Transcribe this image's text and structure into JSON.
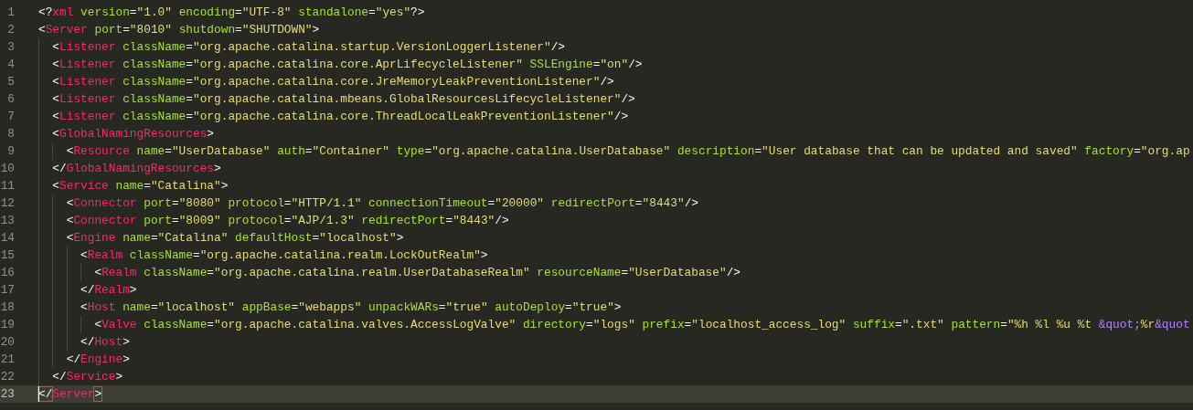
{
  "editor": {
    "lines": [
      {
        "number": "1",
        "text": "<?xml version=\"1.0\" encoding=\"UTF-8\" standalone=\"yes\"?>",
        "current": false
      },
      {
        "number": "2",
        "text": "<Server port=\"8010\" shutdown=\"SHUTDOWN\">",
        "current": false
      },
      {
        "number": "3",
        "text": "  <Listener className=\"org.apache.catalina.startup.VersionLoggerListener\"/>",
        "current": false
      },
      {
        "number": "4",
        "text": "  <Listener className=\"org.apache.catalina.core.AprLifecycleListener\" SSLEngine=\"on\"/>",
        "current": false
      },
      {
        "number": "5",
        "text": "  <Listener className=\"org.apache.catalina.core.JreMemoryLeakPreventionListener\"/>",
        "current": false
      },
      {
        "number": "6",
        "text": "  <Listener className=\"org.apache.catalina.mbeans.GlobalResourcesLifecycleListener\"/>",
        "current": false
      },
      {
        "number": "7",
        "text": "  <Listener className=\"org.apache.catalina.core.ThreadLocalLeakPreventionListener\"/>",
        "current": false
      },
      {
        "number": "8",
        "text": "  <GlobalNamingResources>",
        "current": false
      },
      {
        "number": "9",
        "text": "    <Resource name=\"UserDatabase\" auth=\"Container\" type=\"org.apache.catalina.UserDatabase\" description=\"User database that can be updated and saved\" factory=\"org.ap",
        "current": false
      },
      {
        "number": "10",
        "text": "  </GlobalNamingResources>",
        "current": false
      },
      {
        "number": "11",
        "text": "  <Service name=\"Catalina\">",
        "current": false
      },
      {
        "number": "12",
        "text": "    <Connector port=\"8080\" protocol=\"HTTP/1.1\" connectionTimeout=\"20000\" redirectPort=\"8443\"/>",
        "current": false
      },
      {
        "number": "13",
        "text": "    <Connector port=\"8009\" protocol=\"AJP/1.3\" redirectPort=\"8443\"/>",
        "current": false
      },
      {
        "number": "14",
        "text": "    <Engine name=\"Catalina\" defaultHost=\"localhost\">",
        "current": false
      },
      {
        "number": "15",
        "text": "      <Realm className=\"org.apache.catalina.realm.LockOutRealm\">",
        "current": false
      },
      {
        "number": "16",
        "text": "        <Realm className=\"org.apache.catalina.realm.UserDatabaseRealm\" resourceName=\"UserDatabase\"/>",
        "current": false
      },
      {
        "number": "17",
        "text": "      </Realm>",
        "current": false
      },
      {
        "number": "18",
        "text": "      <Host name=\"localhost\" appBase=\"webapps\" unpackWARs=\"true\" autoDeploy=\"true\">",
        "current": false
      },
      {
        "number": "19",
        "text": "        <Valve className=\"org.apache.catalina.valves.AccessLogValve\" directory=\"logs\" prefix=\"localhost_access_log\" suffix=\".txt\" pattern=\"%h %l %u %t &quot;%r&quot",
        "current": false
      },
      {
        "number": "20",
        "text": "      </Host>",
        "current": false
      },
      {
        "number": "21",
        "text": "    </Engine>",
        "current": false
      },
      {
        "number": "22",
        "text": "  </Service>",
        "current": false
      },
      {
        "number": "23",
        "text": "</Server>",
        "current": true
      }
    ]
  }
}
